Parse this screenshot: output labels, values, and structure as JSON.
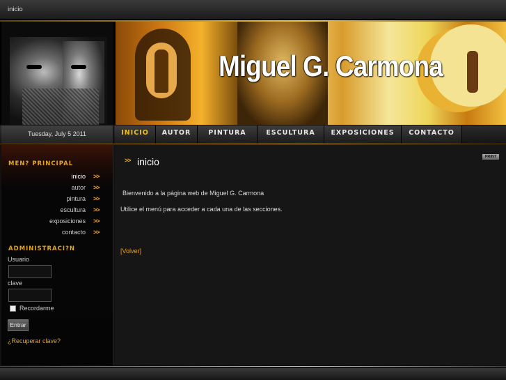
{
  "topbar": {
    "breadcrumb": "inicio"
  },
  "header": {
    "site_title": "Miguel G. Carmona"
  },
  "date": "Tuesday, July 5 2011",
  "nav": [
    {
      "label": "INICIO",
      "active": true
    },
    {
      "label": "AUTOR"
    },
    {
      "label": "PINTURA"
    },
    {
      "label": "ESCULTURA"
    },
    {
      "label": "EXPOSICIONES"
    },
    {
      "label": "CONTACTO"
    }
  ],
  "sidebar": {
    "menu_heading": "MEN? PRINCIPAL",
    "menu": [
      {
        "label": "inicio",
        "arrow": ">>"
      },
      {
        "label": "autor",
        "arrow": ">>"
      },
      {
        "label": "pintura",
        "arrow": ">>"
      },
      {
        "label": "escultura",
        "arrow": ">>"
      },
      {
        "label": "exposiciones",
        "arrow": ">>"
      },
      {
        "label": "contacto",
        "arrow": ">>"
      }
    ],
    "admin_heading": "ADMINISTRACI?N",
    "user_label": "Usuario",
    "pass_label": "clave",
    "remember_label": "Recordarme",
    "submit_label": "Entrar",
    "recover_link": "¿Recuperar clave?"
  },
  "content": {
    "print_label": "PRINT",
    "heading_arrow": ">>",
    "title": "inicio",
    "paragraph1": "Bienvenido a la página web de Miguel G. Carmona",
    "paragraph2": "Utilice el menú para acceder a cada una de las secciones.",
    "back_link": "[Volver]"
  },
  "colors": {
    "accent": "#e3a620",
    "background": "#161616"
  }
}
